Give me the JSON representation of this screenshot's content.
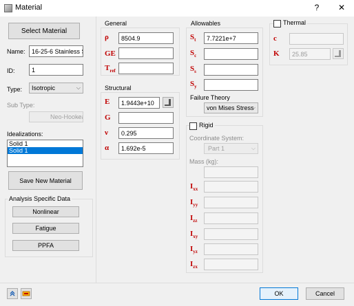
{
  "window": {
    "title": "Material",
    "help_label": "?",
    "close_label": "✕"
  },
  "left": {
    "select_material_label": "Select Material",
    "name_label": "Name:",
    "name_value": "16-25-6 Stainless S",
    "id_label": "ID:",
    "id_value": "1",
    "type_label": "Type:",
    "type_value": "Isotropic",
    "subtype_label": "Sub Type:",
    "subtype_value": "Neo-Hookean",
    "idealizations_label": "Idealizations:",
    "idealizations": [
      "Solid 1",
      "Solid 1"
    ],
    "save_new_label": "Save New Material",
    "analysis_title": "Analysis Specific Data",
    "nonlinear_label": "Nonlinear",
    "fatigue_label": "Fatigue",
    "ppfa_label": "PPFA"
  },
  "general": {
    "title": "General",
    "rows": [
      {
        "sym": "ρ",
        "value": "8504.9"
      },
      {
        "sym": "GE",
        "value": ""
      },
      {
        "sym": "T",
        "sub": "ref",
        "value": ""
      }
    ]
  },
  "structural": {
    "title": "Structural",
    "rows": [
      {
        "sym": "E",
        "value": "1.9443e+10"
      },
      {
        "sym": "G",
        "value": ""
      },
      {
        "sym": "ν",
        "value": "0.295"
      },
      {
        "sym": "α",
        "value": "1.692e-5"
      }
    ]
  },
  "allowables": {
    "title": "Allowables",
    "rows": [
      {
        "sym": "S",
        "sub": "t",
        "value": "7.7221e+7"
      },
      {
        "sym": "S",
        "sub": "c",
        "value": ""
      },
      {
        "sym": "S",
        "sub": "s",
        "value": ""
      },
      {
        "sym": "S",
        "sub": "y",
        "value": ""
      }
    ],
    "failure_label": "Failure Theory",
    "failure_value": "von Mises Stress"
  },
  "rigid": {
    "title": "Rigid",
    "coord_label": "Coordinate System:",
    "coord_value": "Part 1",
    "mass_label": "Mass (kg):",
    "inertia": [
      {
        "sym": "I",
        "sub": "xx"
      },
      {
        "sym": "I",
        "sub": "yy"
      },
      {
        "sym": "I",
        "sub": "zz"
      },
      {
        "sym": "I",
        "sub": "xy"
      },
      {
        "sym": "I",
        "sub": "yz"
      },
      {
        "sym": "I",
        "sub": "zx"
      }
    ]
  },
  "thermal": {
    "title": "Thermal",
    "c_sym": "c",
    "c_value": "",
    "k_sym": "K",
    "k_value": "25.85"
  },
  "footer": {
    "ok_label": "OK",
    "cancel_label": "Cancel"
  },
  "colors": {
    "symbol": "#c00000",
    "accent": "#0078d7"
  }
}
